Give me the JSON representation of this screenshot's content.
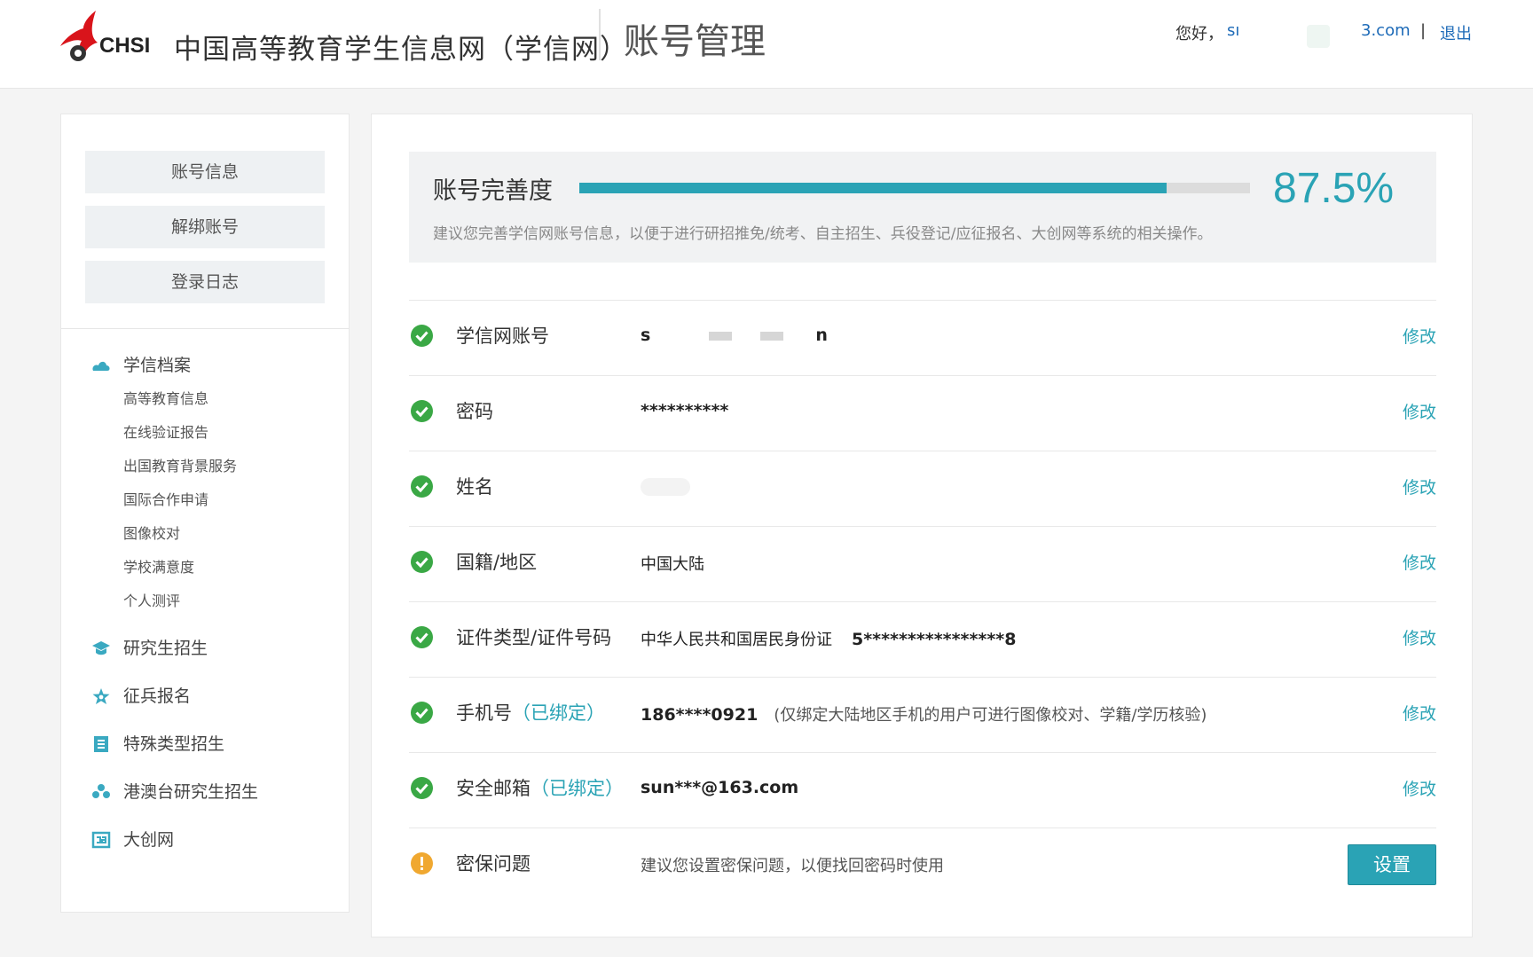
{
  "header": {
    "logo_text": "CHSI",
    "site_name": "中国高等教育学生信息网（学信网）",
    "page_title": "账号管理",
    "greeting": "您好，",
    "username_start": "sı",
    "username_end": "3.com",
    "separator": "|",
    "logout": "退出"
  },
  "sidebar": {
    "buttons": [
      "账号信息",
      "解绑账号",
      "登录日志"
    ],
    "menu": [
      {
        "label": "学信档案",
        "icon": "cloud-icon",
        "children": [
          "高等教育信息",
          "在线验证报告",
          "出国教育背景服务",
          "国际合作申请",
          "图像校对",
          "学校满意度",
          "个人测评"
        ]
      },
      {
        "label": "研究生招生",
        "icon": "graduation-cap-icon",
        "children": []
      },
      {
        "label": "征兵报名",
        "icon": "star-icon",
        "children": []
      },
      {
        "label": "特殊类型招生",
        "icon": "document-icon",
        "children": []
      },
      {
        "label": "港澳台研究生招生",
        "icon": "people-icon",
        "children": []
      },
      {
        "label": "大创网",
        "icon": "innovation-icon",
        "children": []
      }
    ]
  },
  "progress": {
    "label": "账号完善度",
    "percent": 87.5,
    "percent_text": "87.5%",
    "tip": "建议您完善学信网账号信息，以便于进行研招推免/统考、自主招生、兵役登记/应征报名、大创网等系统的相关操作。"
  },
  "rows": [
    {
      "label": "学信网账号",
      "bound": "",
      "value_start": "s",
      "value_end": "n",
      "note": "",
      "action": "修改",
      "status": "ok"
    },
    {
      "label": "密码",
      "bound": "",
      "value": "**********",
      "note": "",
      "action": "修改",
      "status": "ok"
    },
    {
      "label": "姓名",
      "bound": "",
      "value": "",
      "note": "",
      "action": "修改",
      "status": "ok"
    },
    {
      "label": "国籍/地区",
      "bound": "",
      "value": "中国大陆",
      "note": "",
      "action": "修改",
      "status": "ok"
    },
    {
      "label": "证件类型/证件号码",
      "bound": "",
      "value": "中华人民共和国居民身份证",
      "value2": "5****************8",
      "note": "",
      "action": "修改",
      "status": "ok"
    },
    {
      "label": "手机号",
      "bound": "（已绑定）",
      "value": "186****0921",
      "note": "(仅绑定大陆地区手机的用户可进行图像校对、学籍/学历核验)",
      "action": "修改",
      "status": "ok"
    },
    {
      "label": "安全邮箱",
      "bound": "（已绑定）",
      "value": "sun***@163.com",
      "note": "",
      "action": "修改",
      "status": "ok"
    },
    {
      "label": "密保问题",
      "bound": "",
      "value": "建议您设置密保问题，以便找回密码时使用",
      "note": "",
      "action": "设置",
      "status": "warning"
    }
  ],
  "colors": {
    "accent": "#2aa3b5",
    "ok": "#3aa845",
    "warning": "#f0a830",
    "link": "#1e6bb8"
  }
}
